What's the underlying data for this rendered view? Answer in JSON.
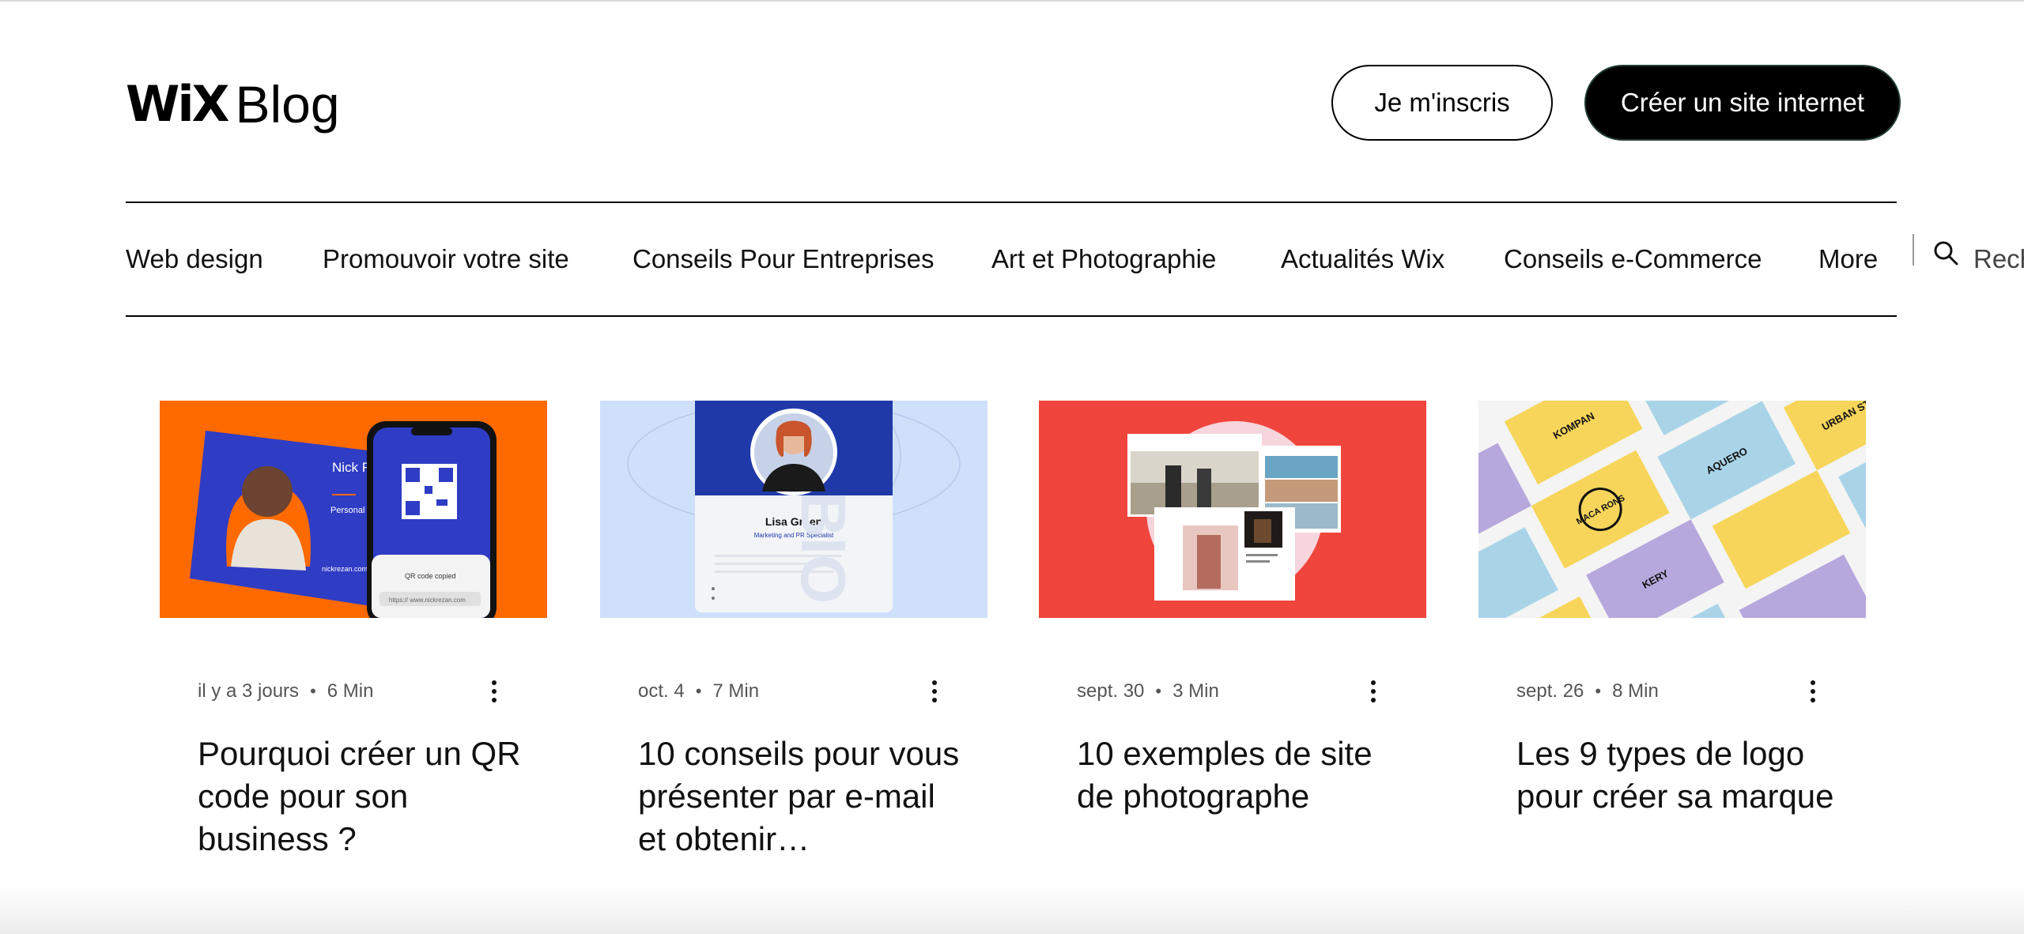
{
  "header": {
    "logo_wix": "WiX",
    "logo_blog": "Blog",
    "signup_label": "Je m'inscris",
    "create_label": "Créer un site internet"
  },
  "nav": {
    "items": [
      "Web design",
      "Promouvoir votre site",
      "Conseils Pour Entreprises",
      "Art et Photographie",
      "Actualités Wix",
      "Conseils e-Commerce",
      "More"
    ],
    "search_text": "Rech"
  },
  "posts": [
    {
      "date": "il y a 3 jours",
      "read_time": "6 Min",
      "title": "Pourquoi créer un QR code pour son business ?",
      "image": {
        "name": "Nick Rezan",
        "role": "Personal Stylist",
        "site": "nickrezan.com",
        "toast": "QR code copied",
        "url": "https:// www.nickrezan.com"
      }
    },
    {
      "date": "oct. 4",
      "read_time": "7 Min",
      "title": "10 conseils pour vous présenter par e-mail et obtenir…",
      "image": {
        "name": "Lisa Green",
        "role": "Marketing and PR Specialist",
        "watermark": "BIO"
      }
    },
    {
      "date": "sept. 30",
      "read_time": "3 Min",
      "title": "10 exemples de site de photographe",
      "image": {}
    },
    {
      "date": "sept. 26",
      "read_time": "8 Min",
      "title": "Les 9 types de logo pour créer sa marque",
      "image": {
        "brand_a": "MACA RONS",
        "brand_b": "KOMPAN",
        "brand_c": "AQUERO",
        "brand_d": "URBAN STOR",
        "brand_e": "KERY"
      }
    }
  ],
  "colors": {
    "thumb_1_bg": "#ff6a00",
    "thumb_1_card": "#2f3cc4",
    "thumb_2_bg": "#cfe0fb",
    "thumb_2_header": "#1f3aa8",
    "thumb_3_bg": "#f0453d",
    "thumb_4_yellow": "#f6d55a",
    "thumb_4_blue": "#a9d4e8",
    "thumb_4_purple": "#b6a8dd"
  }
}
